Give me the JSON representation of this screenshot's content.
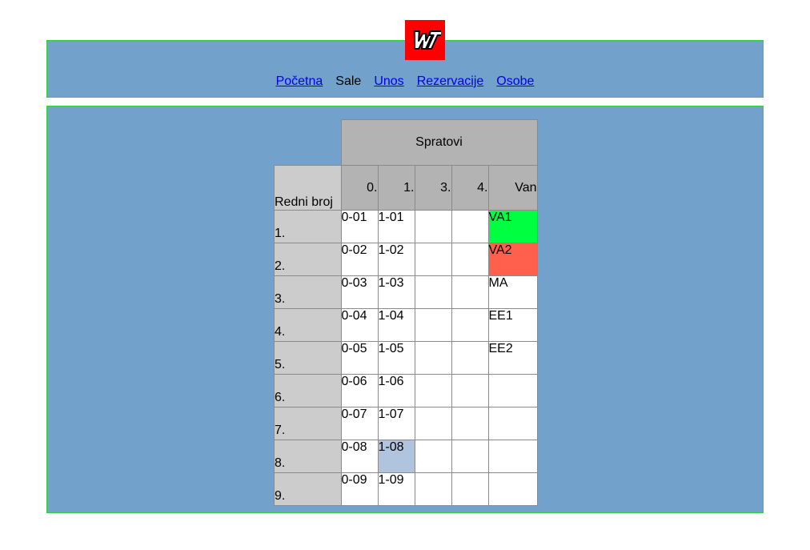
{
  "logo": {
    "icon": "wt-logo-icon",
    "text": "WT",
    "bg_color": "#ff0000"
  },
  "nav": {
    "items": [
      {
        "label": "Početna",
        "link": true
      },
      {
        "label": "Sale",
        "link": false
      },
      {
        "label": "Unos",
        "link": true
      },
      {
        "label": "Rezervacije",
        "link": true
      },
      {
        "label": "Osobe",
        "link": true
      }
    ]
  },
  "table": {
    "group_header": "Spratovi",
    "row_header": "Redni broj",
    "floors": [
      "0.",
      "1.",
      "3.",
      "4.",
      "Van"
    ],
    "rows": [
      {
        "num": "1.",
        "cells": [
          "0-01",
          "1-01",
          "",
          "",
          "VA1"
        ]
      },
      {
        "num": "2.",
        "cells": [
          "0-02",
          "1-02",
          "",
          "",
          "VA2"
        ]
      },
      {
        "num": "3.",
        "cells": [
          "0-03",
          "1-03",
          "",
          "",
          "MA"
        ]
      },
      {
        "num": "4.",
        "cells": [
          "0-04",
          "1-04",
          "",
          "",
          "EE1"
        ]
      },
      {
        "num": "5.",
        "cells": [
          "0-05",
          "1-05",
          "",
          "",
          "EE2"
        ]
      },
      {
        "num": "6.",
        "cells": [
          "0-06",
          "1-06",
          "",
          "",
          ""
        ]
      },
      {
        "num": "7.",
        "cells": [
          "0-07",
          "1-07",
          "",
          "",
          ""
        ]
      },
      {
        "num": "8.",
        "cells": [
          "0-08",
          "1-08",
          "",
          "",
          ""
        ]
      },
      {
        "num": "9.",
        "cells": [
          "0-09",
          "1-09",
          "",
          "",
          ""
        ]
      }
    ],
    "highlight_colors": {
      "VA1": "#00ff40",
      "VA2": "#ff5f4d",
      "1-08": "#b0c4de"
    }
  },
  "colors": {
    "panel_bg": "#72a1cb",
    "panel_border": "#33cc44",
    "header_cell": "#b3b3b3",
    "row_header_cell": "#cccccc"
  }
}
